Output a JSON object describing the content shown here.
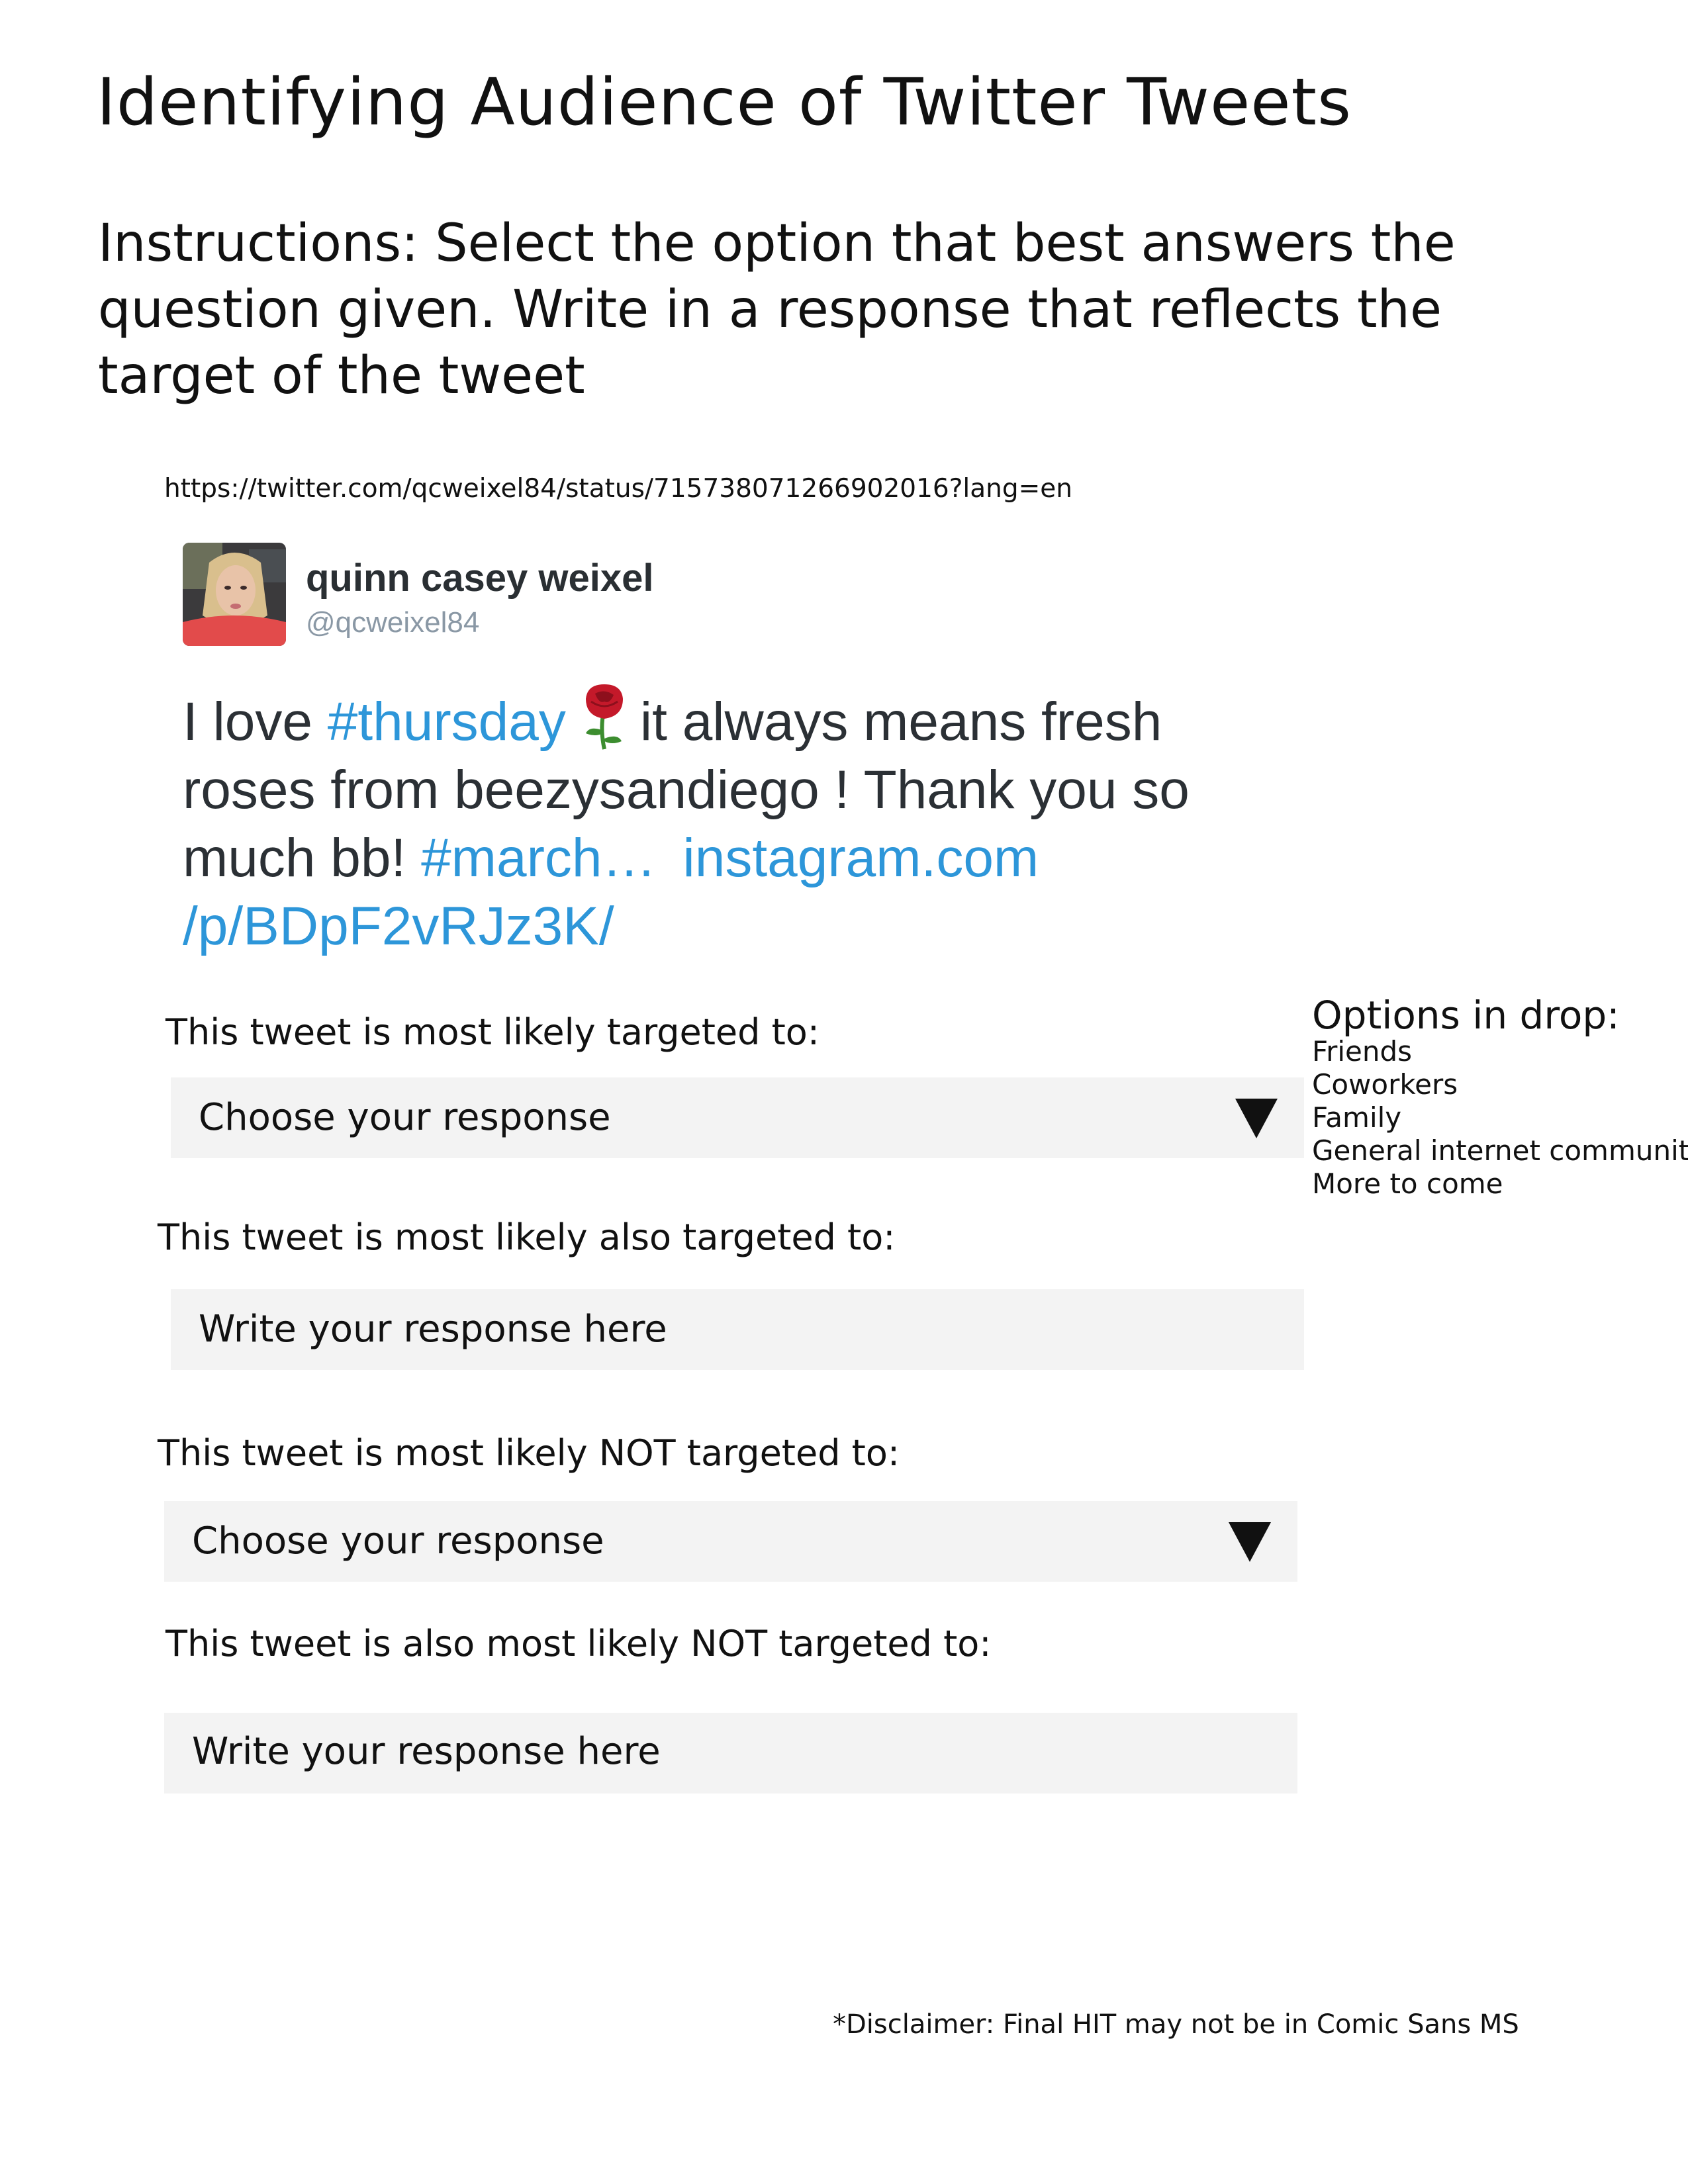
{
  "page": {
    "title": "Identifying Audience of Twitter Tweets",
    "instructions": "Instructions: Select the option that best answers the question given. Write in a response that reflects the target of the tweet",
    "tweet_url": "https://twitter.com/qcweixel84/status/715738071266902016?lang=en"
  },
  "tweet": {
    "author_name": "quinn casey weixel",
    "handle": "@qcweixel84",
    "line1_pre": "I love ",
    "line1_hashtag": "#thursday",
    "line1_post": "it always means fresh",
    "line2": "roses from beezysandiego ! Thank you so",
    "line3_pre": "much bb! ",
    "line3_hashtag": "#march…",
    "line3_link": "instagram.com",
    "line4_link": "/p/BDpF2vRJz3K/",
    "emoji_icon": "rose-emoji"
  },
  "questions": [
    {
      "label": "This tweet is most likely targeted to:",
      "type": "dropdown",
      "value": "Choose your response"
    },
    {
      "label": "This tweet is most likely also targeted to:",
      "type": "text",
      "placeholder": "Write your response here"
    },
    {
      "label": "This tweet is most likely NOT targeted to:",
      "type": "dropdown",
      "value": "Choose your response"
    },
    {
      "label": "This tweet is also most likely NOT targeted to:",
      "type": "text",
      "placeholder": "Write your response here"
    }
  ],
  "dropdown_options": {
    "title": "Options in drop:",
    "items": [
      "Friends",
      "Coworkers",
      "Family",
      "General internet community",
      "More to come"
    ]
  },
  "disclaimer": "*Disclaimer: Final HIT may not be in Comic Sans MS",
  "colors": {
    "link": "#2d96d9",
    "field_bg": "#f3f3f3",
    "handle": "#8a98a5"
  }
}
